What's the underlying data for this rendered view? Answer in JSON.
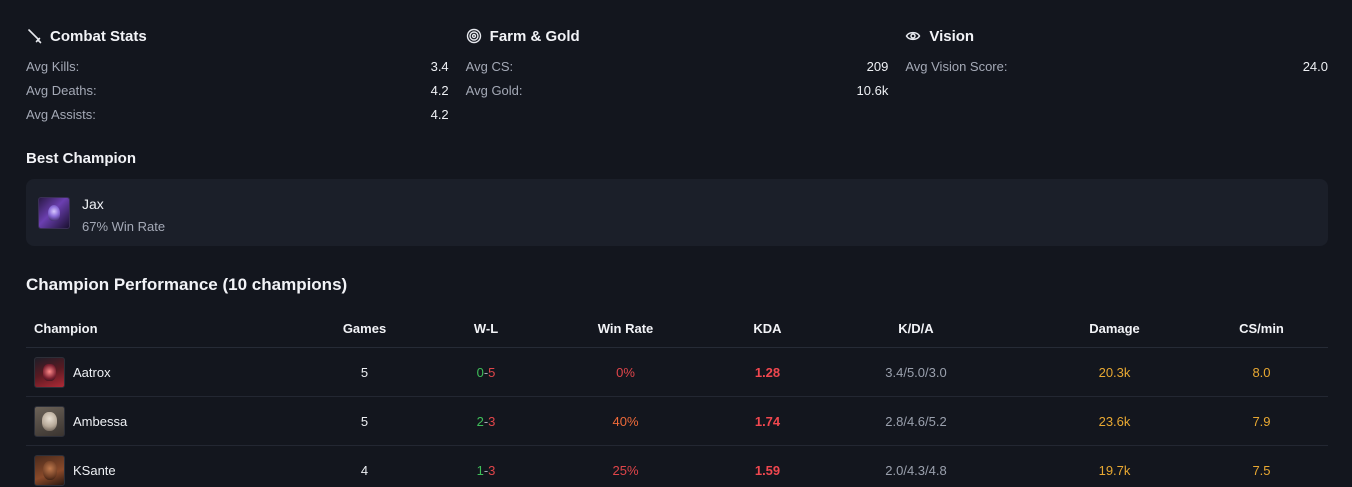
{
  "stats": {
    "combat": {
      "title": "Combat Stats",
      "icon": "sword-icon",
      "rows": [
        {
          "label": "Avg Kills:",
          "value": "3.4"
        },
        {
          "label": "Avg Deaths:",
          "value": "4.2"
        },
        {
          "label": "Avg Assists:",
          "value": "4.2"
        }
      ]
    },
    "farm": {
      "title": "Farm & Gold",
      "icon": "target-icon",
      "rows": [
        {
          "label": "Avg CS:",
          "value": "209"
        },
        {
          "label": "Avg Gold:",
          "value": "10.6k"
        }
      ]
    },
    "vision": {
      "title": "Vision",
      "icon": "eye-icon",
      "rows": [
        {
          "label": "Avg Vision Score:",
          "value": "24.0"
        }
      ]
    }
  },
  "best_champion": {
    "heading": "Best Champion",
    "name": "Jax",
    "win_rate": "67% Win Rate"
  },
  "performance": {
    "heading": "Champion Performance (10 champions)",
    "columns": [
      "Champion",
      "Games",
      "W-L",
      "Win Rate",
      "KDA",
      "K/D/A",
      "Damage",
      "CS/min"
    ],
    "rows": [
      {
        "champion": "Aatrox",
        "games": "5",
        "wins": "0",
        "losses": "5",
        "win_rate": "0%",
        "win_rate_color": "#e0454a",
        "kda": "1.28",
        "kda_line": "3.4/5.0/3.0",
        "damage": "20.3k",
        "cs_min": "8.0"
      },
      {
        "champion": "Ambessa",
        "games": "5",
        "wins": "2",
        "losses": "3",
        "win_rate": "40%",
        "win_rate_color": "#ee6a3a",
        "kda": "1.74",
        "kda_line": "2.8/4.6/5.2",
        "damage": "23.6k",
        "cs_min": "7.9"
      },
      {
        "champion": "KSante",
        "games": "4",
        "wins": "1",
        "losses": "3",
        "win_rate": "25%",
        "win_rate_color": "#e0454a",
        "kda": "1.59",
        "kda_line": "2.0/4.3/4.8",
        "damage": "19.7k",
        "cs_min": "7.5"
      }
    ]
  },
  "colors": {
    "background": "#13161e",
    "card": "#1b1f29",
    "win": "#3fbf5a",
    "loss": "#e0454a",
    "kda": "#f0474f",
    "damage": "#e8a832"
  }
}
